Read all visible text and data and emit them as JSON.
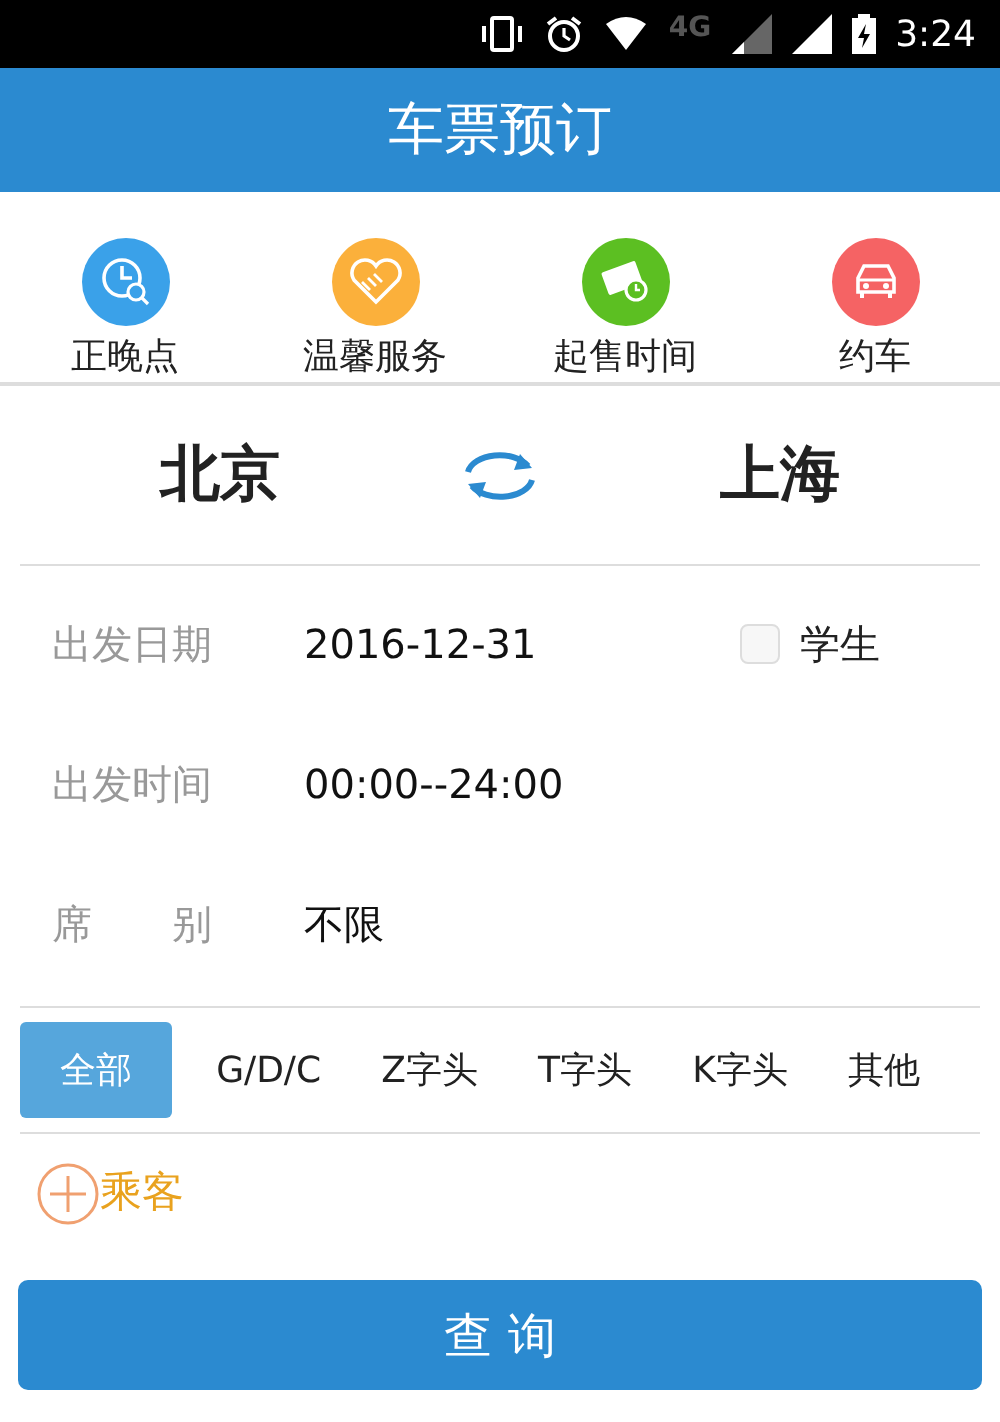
{
  "status_bar": {
    "network": "4G",
    "time": "3:24"
  },
  "title": "车票预订",
  "shortcuts": [
    {
      "label": "正晚点",
      "color": "#3aa1e9",
      "kind": "clock"
    },
    {
      "label": "温馨服务",
      "color": "#fbb03b",
      "kind": "heart"
    },
    {
      "label": "起售时间",
      "color": "#5cbf22",
      "kind": "ticket"
    },
    {
      "label": "约车",
      "color": "#f56364",
      "kind": "car"
    }
  ],
  "stations": {
    "from": "北京",
    "to": "上海"
  },
  "fields": [
    {
      "label": "出发日期",
      "value": "2016-12-31"
    },
    {
      "label": "出发时间",
      "value": "00:00--24:00"
    },
    {
      "label": "席　　别",
      "value": "不限"
    }
  ],
  "student": {
    "label": "学生",
    "checked": false
  },
  "train_types": [
    {
      "label": "全部",
      "selected": true
    },
    {
      "label": "G/D/C",
      "selected": false
    },
    {
      "label": "Z字头",
      "selected": false
    },
    {
      "label": "T字头",
      "selected": false
    },
    {
      "label": "K字头",
      "selected": false
    },
    {
      "label": "其他",
      "selected": false
    }
  ],
  "add_passenger": {
    "label": "乘客"
  },
  "search_button": "查 询"
}
